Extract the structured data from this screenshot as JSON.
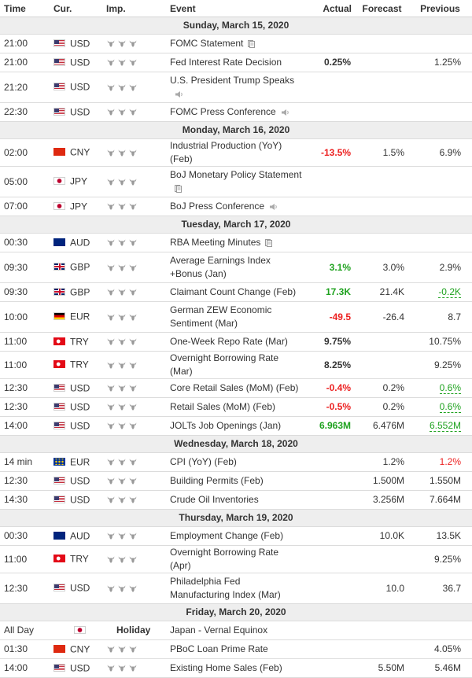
{
  "header": {
    "time": "Time",
    "currency": "Cur.",
    "importance": "Imp.",
    "event": "Event",
    "actual": "Actual",
    "forecast": "Forecast",
    "previous": "Previous"
  },
  "days": [
    {
      "date": "Sunday, March 15, 2020",
      "events": [
        {
          "time": "21:00",
          "flag": "us",
          "currency": "USD",
          "bulls": 3,
          "event": "FOMC Statement",
          "icon": "document-icon",
          "actual": "",
          "actual_color": "",
          "forecast": "",
          "previous": "",
          "previous_style": ""
        },
        {
          "time": "21:00",
          "flag": "us",
          "currency": "USD",
          "bulls": 3,
          "event": "Fed Interest Rate Decision",
          "icon": "",
          "actual": "0.25%",
          "actual_color": "dark",
          "forecast": "",
          "previous": "1.25%",
          "previous_style": ""
        },
        {
          "time": "21:20",
          "flag": "us",
          "currency": "USD",
          "bulls": 3,
          "event": "U.S. President Trump Speaks",
          "icon": "speaker-icon",
          "two_line": true,
          "actual": "",
          "actual_color": "",
          "forecast": "",
          "previous": "",
          "previous_style": ""
        },
        {
          "time": "22:30",
          "flag": "us",
          "currency": "USD",
          "bulls": 3,
          "event": "FOMC Press Conference",
          "icon": "speaker-icon",
          "actual": "",
          "actual_color": "",
          "forecast": "",
          "previous": "",
          "previous_style": ""
        }
      ]
    },
    {
      "date": "Monday, March 16, 2020",
      "events": [
        {
          "time": "02:00",
          "flag": "cn",
          "currency": "CNY",
          "bulls": 3,
          "event": "Industrial Production (YoY) (Feb)",
          "icon": "",
          "actual": "-13.5%",
          "actual_color": "red",
          "forecast": "1.5%",
          "previous": "6.9%",
          "previous_style": ""
        },
        {
          "time": "05:00",
          "flag": "jp",
          "currency": "JPY",
          "bulls": 3,
          "event": "BoJ Monetary Policy Statement",
          "icon": "document-icon",
          "two_line": true,
          "actual": "",
          "actual_color": "",
          "forecast": "",
          "previous": "",
          "previous_style": ""
        },
        {
          "time": "07:00",
          "flag": "jp",
          "currency": "JPY",
          "bulls": 3,
          "event": "BoJ Press Conference",
          "icon": "speaker-icon",
          "actual": "",
          "actual_color": "",
          "forecast": "",
          "previous": "",
          "previous_style": ""
        }
      ]
    },
    {
      "date": "Tuesday, March 17, 2020",
      "events": [
        {
          "time": "00:30",
          "flag": "au",
          "currency": "AUD",
          "bulls": 3,
          "event": "RBA Meeting Minutes",
          "icon": "document-icon",
          "actual": "",
          "actual_color": "",
          "forecast": "",
          "previous": "",
          "previous_style": ""
        },
        {
          "time": "09:30",
          "flag": "gb",
          "currency": "GBP",
          "bulls": 3,
          "event": "Average Earnings Index +Bonus (Jan)",
          "icon": "",
          "two_line": true,
          "actual": "3.1%",
          "actual_color": "green",
          "forecast": "3.0%",
          "previous": "2.9%",
          "previous_style": ""
        },
        {
          "time": "09:30",
          "flag": "gb",
          "currency": "GBP",
          "bulls": 3,
          "event": "Claimant Count Change (Feb)",
          "icon": "",
          "actual": "17.3K",
          "actual_color": "green",
          "forecast": "21.4K",
          "previous": "-0.2K",
          "previous_style": "green-dash"
        },
        {
          "time": "10:00",
          "flag": "de",
          "currency": "EUR",
          "bulls": 3,
          "event": "German ZEW Economic Sentiment (Mar)",
          "icon": "",
          "two_line": true,
          "actual": "-49.5",
          "actual_color": "red",
          "forecast": "-26.4",
          "previous": "8.7",
          "previous_style": ""
        },
        {
          "time": "11:00",
          "flag": "tr",
          "currency": "TRY",
          "bulls": 3,
          "event": "One-Week Repo Rate (Mar)",
          "icon": "",
          "actual": "9.75%",
          "actual_color": "dark",
          "forecast": "",
          "previous": "10.75%",
          "previous_style": ""
        },
        {
          "time": "11:00",
          "flag": "tr",
          "currency": "TRY",
          "bulls": 3,
          "event": "Overnight Borrowing Rate (Mar)",
          "icon": "",
          "actual": "8.25%",
          "actual_color": "dark",
          "forecast": "",
          "previous": "9.25%",
          "previous_style": ""
        },
        {
          "time": "12:30",
          "flag": "us",
          "currency": "USD",
          "bulls": 3,
          "event": "Core Retail Sales (MoM) (Feb)",
          "icon": "",
          "actual": "-0.4%",
          "actual_color": "red",
          "forecast": "0.2%",
          "previous": "0.6%",
          "previous_style": "green-dash"
        },
        {
          "time": "12:30",
          "flag": "us",
          "currency": "USD",
          "bulls": 3,
          "event": "Retail Sales (MoM) (Feb)",
          "icon": "",
          "actual": "-0.5%",
          "actual_color": "red",
          "forecast": "0.2%",
          "previous": "0.6%",
          "previous_style": "green-dash"
        },
        {
          "time": "14:00",
          "flag": "us",
          "currency": "USD",
          "bulls": 3,
          "event": "JOLTs Job Openings (Jan)",
          "icon": "",
          "actual": "6.963M",
          "actual_color": "green",
          "forecast": "6.476M",
          "previous": "6.552M",
          "previous_style": "green-dash"
        }
      ]
    },
    {
      "date": "Wednesday, March 18, 2020",
      "events": [
        {
          "time": "14 min",
          "flag": "eu",
          "currency": "EUR",
          "bulls": 3,
          "event": "CPI (YoY) (Feb)",
          "icon": "",
          "actual": "",
          "actual_color": "",
          "forecast": "1.2%",
          "previous": "1.2%",
          "previous_style": "red"
        },
        {
          "time": "12:30",
          "flag": "us",
          "currency": "USD",
          "bulls": 3,
          "event": "Building Permits (Feb)",
          "icon": "",
          "actual": "",
          "actual_color": "",
          "forecast": "1.500M",
          "previous": "1.550M",
          "previous_style": ""
        },
        {
          "time": "14:30",
          "flag": "us",
          "currency": "USD",
          "bulls": 3,
          "event": "Crude Oil Inventories",
          "icon": "",
          "actual": "",
          "actual_color": "",
          "forecast": "3.256M",
          "previous": "7.664M",
          "previous_style": ""
        }
      ]
    },
    {
      "date": "Thursday, March 19, 2020",
      "events": [
        {
          "time": "00:30",
          "flag": "au",
          "currency": "AUD",
          "bulls": 3,
          "event": "Employment Change (Feb)",
          "icon": "",
          "actual": "",
          "actual_color": "",
          "forecast": "10.0K",
          "previous": "13.5K",
          "previous_style": ""
        },
        {
          "time": "11:00",
          "flag": "tr",
          "currency": "TRY",
          "bulls": 3,
          "event": "Overnight Borrowing Rate (Apr)",
          "icon": "",
          "actual": "",
          "actual_color": "",
          "forecast": "",
          "previous": "9.25%",
          "previous_style": ""
        },
        {
          "time": "12:30",
          "flag": "us",
          "currency": "USD",
          "bulls": 3,
          "event": "Philadelphia Fed Manufacturing Index (Mar)",
          "icon": "",
          "two_line": true,
          "actual": "",
          "actual_color": "",
          "forecast": "10.0",
          "previous": "36.7",
          "previous_style": ""
        }
      ]
    },
    {
      "date": "Friday, March 20, 2020",
      "events": [
        {
          "time": "All Day",
          "flag": "jp",
          "currency": "",
          "bulls": 0,
          "holiday": "Holiday",
          "event": "Japan - Vernal Equinox",
          "icon": "",
          "actual": "",
          "actual_color": "",
          "forecast": "",
          "previous": "",
          "previous_style": ""
        },
        {
          "time": "01:30",
          "flag": "cn",
          "currency": "CNY",
          "bulls": 3,
          "event": "PBoC Loan Prime Rate",
          "icon": "",
          "actual": "",
          "actual_color": "",
          "forecast": "",
          "previous": "4.05%",
          "previous_style": ""
        },
        {
          "time": "14:00",
          "flag": "us",
          "currency": "USD",
          "bulls": 3,
          "event": "Existing Home Sales (Feb)",
          "icon": "",
          "actual": "",
          "actual_color": "",
          "forecast": "5.50M",
          "previous": "5.46M",
          "previous_style": ""
        }
      ]
    }
  ]
}
